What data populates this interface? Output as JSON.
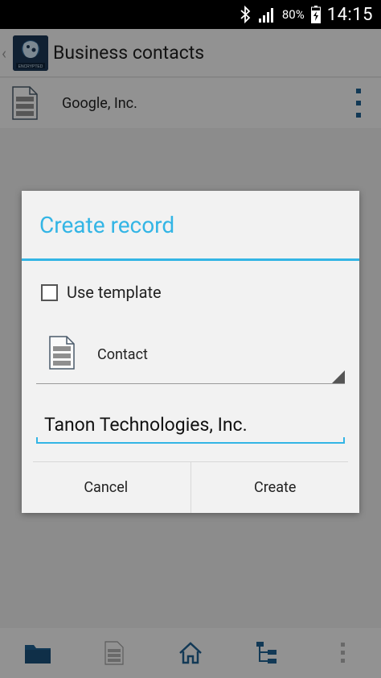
{
  "status_bar": {
    "battery_percent": "80%",
    "time": "14:15",
    "icons": [
      "bluetooth-icon",
      "signal-icon",
      "battery-charging-icon"
    ]
  },
  "action_bar": {
    "title": "Business contacts",
    "app_icon": "encrypted-app-icon",
    "app_icon_text": "ENCRYPTED"
  },
  "list": {
    "items": [
      {
        "label": "Google, Inc.",
        "icon": "document-icon"
      }
    ]
  },
  "dialog": {
    "title": "Create record",
    "use_template": {
      "label": "Use template",
      "checked": false
    },
    "template_select": {
      "selected": "Contact",
      "icon": "document-icon"
    },
    "name_input": {
      "value": "Tanon Technologies, Inc."
    },
    "buttons": {
      "cancel": "Cancel",
      "create": "Create"
    }
  },
  "bottom_nav": {
    "items": [
      "folder-icon",
      "document-icon",
      "home-icon",
      "tree-icon",
      "overflow-icon"
    ]
  },
  "colors": {
    "accent": "#33b5e5",
    "nav_icon": "#1f5f8f"
  }
}
